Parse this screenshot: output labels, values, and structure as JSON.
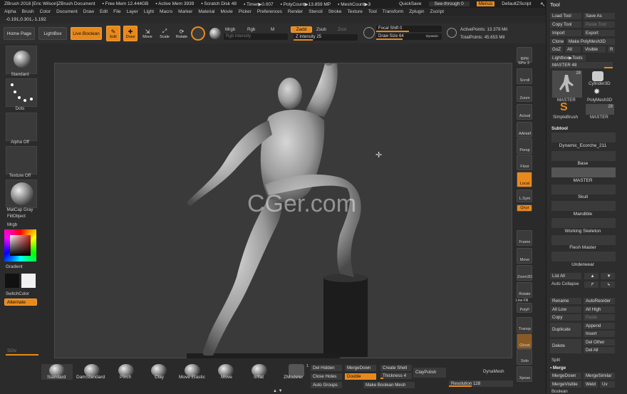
{
  "titlebar": {
    "items": [
      "ZBrush 2018 [Eric Wilson]ZBrush Document",
      "▪ Free Mem 12.444GB",
      "▪ Active Mem 3939",
      "▪ Scratch Disk 48",
      "▪ Timer▶0.007",
      "▪ PolyCount▶13.859 MP",
      "▪ MeshCount▶3"
    ],
    "quicksave": "QuickSave",
    "seethrough": "See-through  0",
    "menus": "Menus",
    "script": "DefaultZScript"
  },
  "menubar": [
    "Alpha",
    "Brush",
    "Color",
    "Document",
    "Draw",
    "Edit",
    "File",
    "Layer",
    "Light",
    "Macro",
    "Marker",
    "Material",
    "Movie",
    "Picker",
    "Preferences",
    "Render",
    "Stencil",
    "Stroke",
    "Texture",
    "Tool",
    "Transform",
    "Zplugin",
    "Zscript"
  ],
  "coords": "-0.191,0.301,-1.192",
  "topshelf": {
    "home": "Home Page",
    "lightbox": "LightBox",
    "liveboolean": "Live Boolean",
    "edit": "Edit",
    "draw": "Draw",
    "move": "Move",
    "scale": "Scale",
    "rotate": "Rotate",
    "mrgb": "Mrgb",
    "rgb": "Rgb",
    "m": "M",
    "rgb_intensity": "Rgb Intensity",
    "zadd": "Zadd",
    "zsub": "Zsub",
    "zcut": "Zcut",
    "z_intensity": "Z Intensity 25",
    "focal": "Focal Shift 0",
    "drawsize": "Draw Size 64",
    "dynamic": "Dynamic",
    "activepoints": "ActivePoints: 13.379 Mil",
    "totalpoints": "TotalPoints: 45.653 Mil"
  },
  "leftpanel": {
    "standard": "Standard",
    "dots": "Dots",
    "alpha": "Alpha Off",
    "texture": "Texture Off",
    "matcap": "MatCap Gray",
    "fillobject": "FillObject",
    "mrgb": "Mrgb",
    "gradient": "Gradient",
    "switchcolor": "SwitchColor",
    "alternate": "Alternate",
    "sdiv": "SDiv"
  },
  "canvas": {
    "watermark": "CGer.com"
  },
  "rightshelf": [
    "BPR",
    "SPix 3",
    "Scroll",
    "Zoom",
    "Actual",
    "AAHalf",
    "Persp",
    "Floor",
    "Local",
    "L.Sym",
    "Qxyz",
    "Frame",
    "Move",
    "Zoom3D",
    "Rotate",
    "Line Fill",
    "PolyF",
    "Transp",
    "Ghost",
    "Solo",
    "Xpose"
  ],
  "toolpanel": {
    "title": "Tool",
    "loadtool": "Load Tool",
    "saveas": "Save As",
    "copytool": "Copy Tool",
    "pastetool": "Paste Tool",
    "import": "Import",
    "export": "Export",
    "clone": "Clone",
    "makepolymesh": "Make PolyMesh3D",
    "goz": "GoZ",
    "all": "All",
    "visible": "Visible",
    "r": "R",
    "lightboxtools": "Lightbox▶Tools",
    "master": "MASTER  48",
    "thumbs": [
      "MASTER",
      "Cylinder3D",
      "PolyMesh3D",
      "SimpleBrush",
      "MASTER"
    ],
    "thumbcounts": [
      "28",
      "28"
    ],
    "subtool": "Subtool",
    "subtools": [
      "Dynamic_Ecorche_211",
      "Base",
      "MASTER",
      "Skull",
      "Mandible",
      "Working Skeleton",
      "Flesh Master",
      "Underwear"
    ],
    "listall": "List All",
    "autocollapse": "Auto Collapse",
    "rename": "Rename",
    "autoreorder": "AutoReorder",
    "alllow": "All Low",
    "allhigh": "All High",
    "copy": "Copy",
    "paste": "Paste",
    "duplicate": "Duplicate",
    "append": "Append",
    "insert": "Insert",
    "delete": "Delete",
    "delother": "Del Other",
    "delall": "Del All",
    "split": "Split",
    "merge": "Merge",
    "mergedown": "MergeDown",
    "mergesimilar": "MergeSimilar",
    "mergevisible": "MergeVisible",
    "weld": "Weld",
    "uv": "Uv",
    "boolean": "Boolean"
  },
  "bottomshelf": {
    "brushes": [
      "Standard",
      "DamStandard",
      "Pinch",
      "Clay",
      "Move Elastic",
      "Move",
      "Inflat",
      "ZModeler"
    ],
    "zmodeler_num": "1",
    "delhidden": "Del Hidden",
    "mergedown": "MergeDown",
    "createshell": "Create Shell",
    "closeholes": "Close Holes",
    "double": "Double",
    "thickness": "Thickness 4",
    "autogroups": "Auto Groups",
    "makeboolean": "Make Boolean Mesh",
    "claypolish": "ClayPolish",
    "dynamesh": "DynaMesh",
    "resolution": "Resolution 128"
  },
  "colors": {
    "accent": "#e8891c",
    "bg": "#2a2a2a",
    "canvas": "#3a3a3a"
  }
}
